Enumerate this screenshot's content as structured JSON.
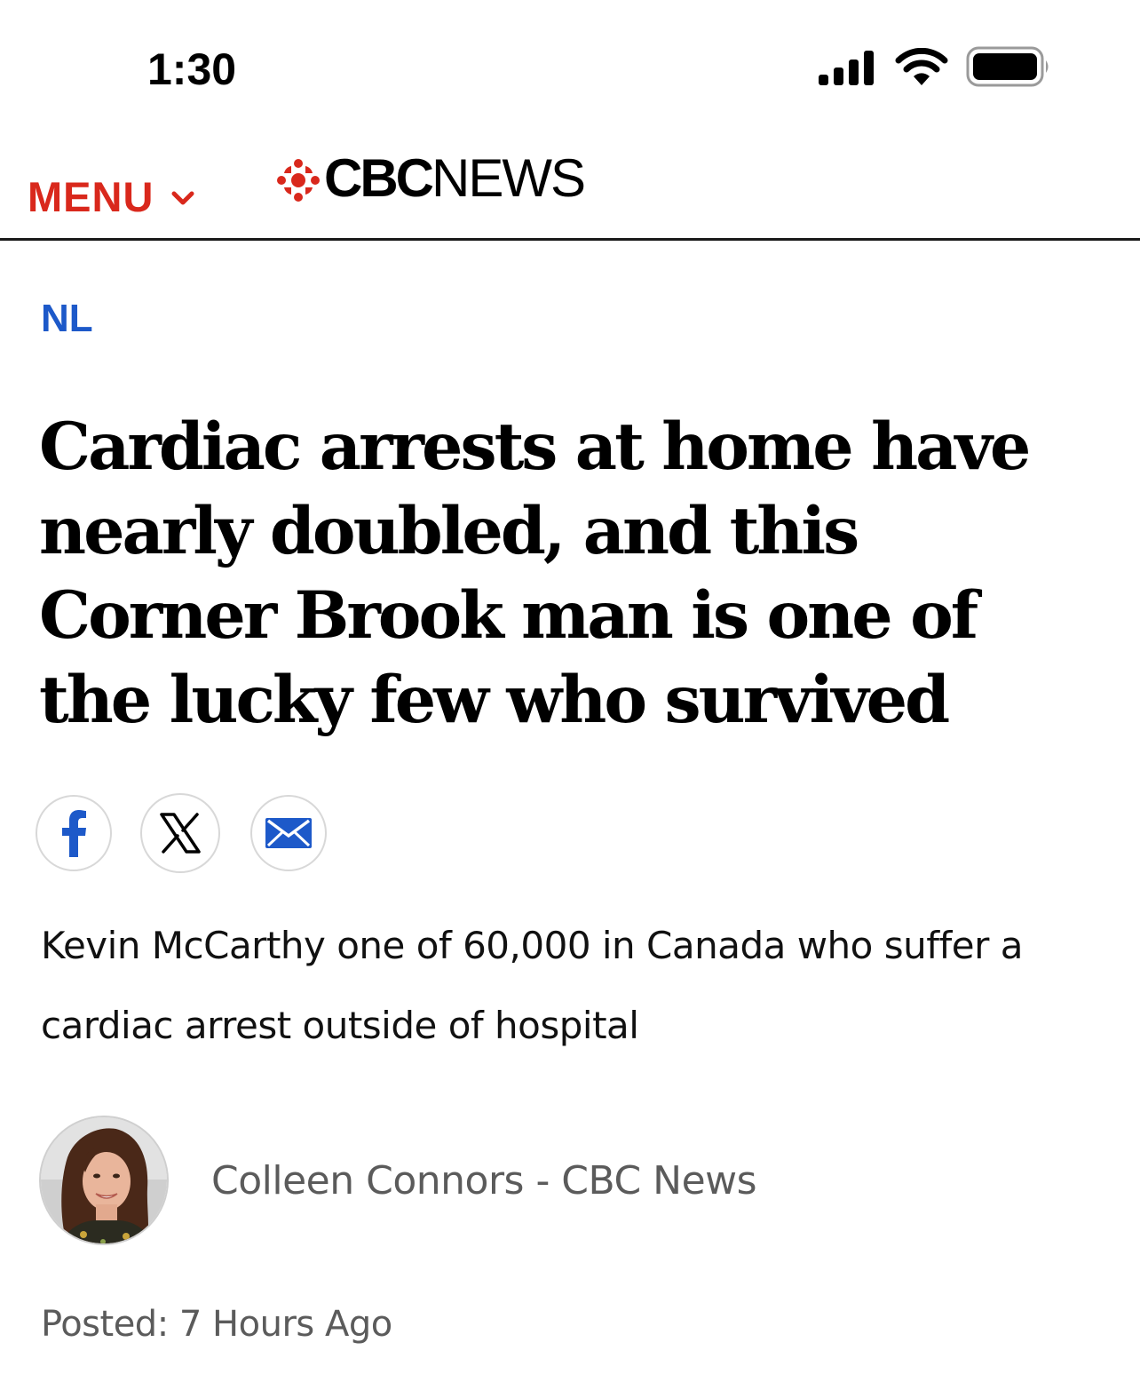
{
  "status_bar": {
    "time": "1:30",
    "icons": [
      "signal-icon",
      "wifi-icon",
      "battery-icon"
    ]
  },
  "header": {
    "menu_label": "MENU",
    "brand_bold": "CBC",
    "brand_light": "NEWS",
    "menu_color": "#d9281c"
  },
  "article": {
    "section": "NL",
    "section_color": "#1d59c9",
    "headline": "Cardiac arrests at home have nearly doubled, and this Corner Brook man is one of the lucky few who survived",
    "share": {
      "icons": [
        "facebook-icon",
        "x-icon",
        "email-icon"
      ],
      "facebook_color": "#1d59c9",
      "email_color": "#1d59c9"
    },
    "deck": "Kevin McCarthy one of 60,000 in Canada who suffer a cardiac arrest outside of hospital",
    "byline": "Colleen Connors - CBC News",
    "posted": "Posted: 7 Hours Ago"
  }
}
